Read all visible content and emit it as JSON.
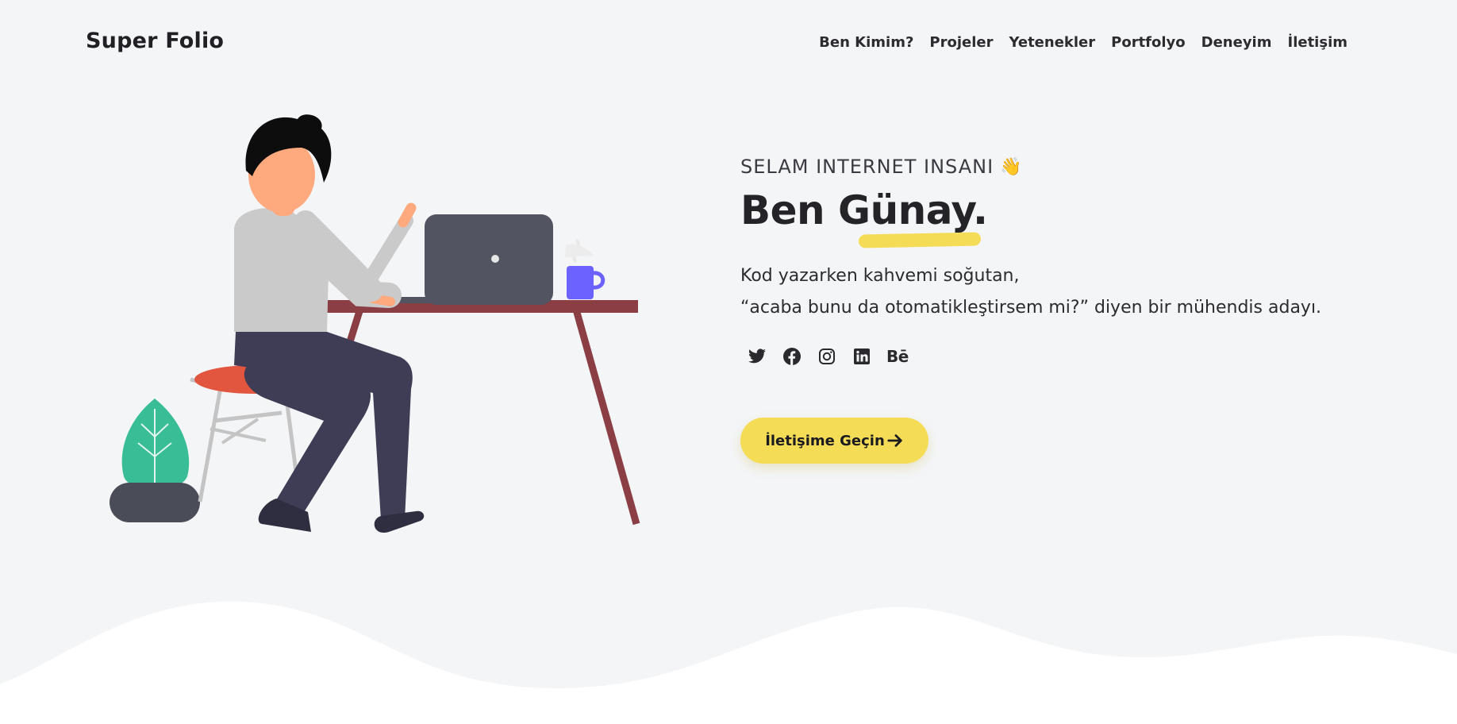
{
  "header": {
    "brand": "Super Folio",
    "nav": [
      {
        "label": "Ben Kimim?"
      },
      {
        "label": "Projeler"
      },
      {
        "label": "Yetenekler"
      },
      {
        "label": "Portfolyo"
      },
      {
        "label": "Deneyim"
      },
      {
        "label": "İletişim"
      }
    ]
  },
  "hero": {
    "greeting": "SELAM INTERNET INSANI",
    "greeting_emoji": "👋",
    "name": "Ben Günay.",
    "bio_line1": "Kod yazarken kahvemi soğutan,",
    "bio_line2": "“acaba bunu da otomatikleştirsem mi?” diyen bir mühendis adayı.",
    "cta_label": "İletişime Geçin"
  },
  "socials": [
    {
      "icon": "twitter-icon"
    },
    {
      "icon": "facebook-icon"
    },
    {
      "icon": "instagram-icon"
    },
    {
      "icon": "linkedin-icon"
    },
    {
      "icon": "behance-icon",
      "text": "Bē"
    }
  ],
  "colors": {
    "background": "#f4f5f7",
    "accent": "#f5dc57",
    "text": "#26262a",
    "plant": "#38bd96",
    "mug": "#6c63ff",
    "desk": "#8b3f45"
  }
}
